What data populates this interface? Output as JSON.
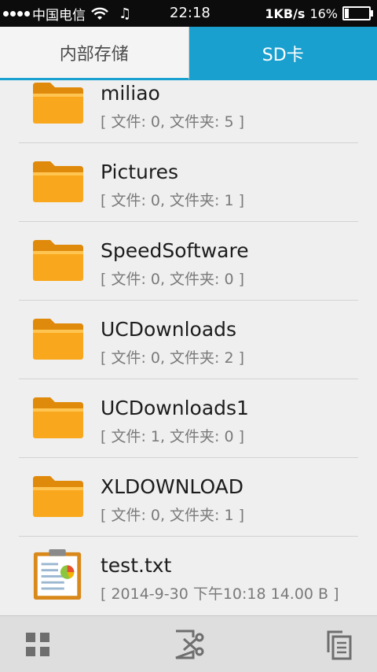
{
  "status_bar": {
    "carrier": "中国电信",
    "time": "22:18",
    "net_speed": "1KB/s",
    "battery": "16%"
  },
  "tabs": [
    {
      "label": "内部存储",
      "selected": false
    },
    {
      "label": "SD卡",
      "selected": true
    }
  ],
  "files": [
    {
      "name": "miliao",
      "meta": "[ 文件: 0, 文件夹: 5 ]",
      "icon": "folder-icon"
    },
    {
      "name": "Pictures",
      "meta": "[ 文件: 0, 文件夹: 1 ]",
      "icon": "folder-icon"
    },
    {
      "name": "SpeedSoftware",
      "meta": "[ 文件: 0, 文件夹: 0 ]",
      "icon": "folder-icon"
    },
    {
      "name": "UCDownloads",
      "meta": "[ 文件: 0, 文件夹: 2 ]",
      "icon": "folder-icon"
    },
    {
      "name": "UCDownloads1",
      "meta": "[ 文件: 1, 文件夹: 0 ]",
      "icon": "folder-icon"
    },
    {
      "name": "XLDOWNLOAD",
      "meta": "[ 文件: 0, 文件夹: 1 ]",
      "icon": "folder-icon"
    },
    {
      "name": "test.txt",
      "meta": "[ 2014-9-30 下午10:18 14.00 B ]",
      "icon": "text-file-icon"
    }
  ],
  "bottom_bar": {
    "buttons": [
      "grid-view-icon",
      "cut-icon",
      "copy-icon"
    ]
  },
  "colors": {
    "accent": "#1aa0cf",
    "folder": "#f7a51b"
  }
}
